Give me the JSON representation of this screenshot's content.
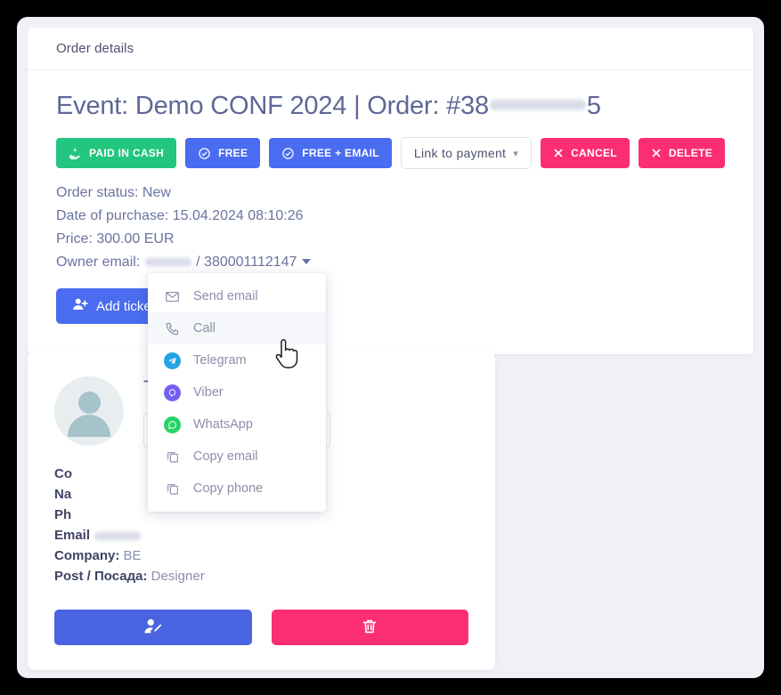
{
  "window": {
    "background_color": "#f0f1f7",
    "frame_color": "#000000"
  },
  "panel": {
    "header_title": "Order details"
  },
  "order": {
    "title_prefix": "Event: Demo CONF 2024 | Order: #38",
    "title_suffix": "5",
    "status_label": "Order status: New",
    "date_label": "Date of purchase: 15.04.2024 08:10:26",
    "price_label": "Price: 300.00 EUR",
    "owner_prefix": "Owner email: ",
    "owner_phone": " / 380001112147"
  },
  "actions": {
    "paid_in_cash": "PAID IN CASH",
    "free": "FREE",
    "free_email": "FREE + EMAIL",
    "link_to_payment": "Link to payment",
    "cancel": "CANCEL",
    "delete": "DELETE",
    "add_ticket": "Add ticket"
  },
  "colors": {
    "green": "#22c67f",
    "blue": "#4a6cf0",
    "pink": "#fb2e72",
    "heading": "#5f6796",
    "muted": "#8b90ab"
  },
  "dropdown": {
    "items": [
      {
        "label": "Send email",
        "icon": "envelope-icon"
      },
      {
        "label": "Call",
        "icon": "phone-icon"
      },
      {
        "label": "Telegram",
        "icon": "telegram-icon"
      },
      {
        "label": "Viber",
        "icon": "viber-icon"
      },
      {
        "label": "WhatsApp",
        "icon": "whatsapp-icon"
      },
      {
        "label": "Copy email",
        "icon": "copy-icon"
      },
      {
        "label": "Copy phone",
        "icon": "copy-icon"
      }
    ],
    "hovered_index": 1
  },
  "contact": {
    "name_initial": "T",
    "rows": [
      {
        "label": "Co",
        "value": ""
      },
      {
        "label": "Na",
        "value": ""
      },
      {
        "label": "Ph",
        "value": ""
      },
      {
        "label": "Email",
        "value": ""
      },
      {
        "label": "Company:",
        "value": "BE"
      },
      {
        "label": "Post / Посада:",
        "value": "Designer"
      }
    ]
  },
  "card_actions": {
    "edit_icon": "user-edit-icon",
    "delete_icon": "trash-icon"
  }
}
